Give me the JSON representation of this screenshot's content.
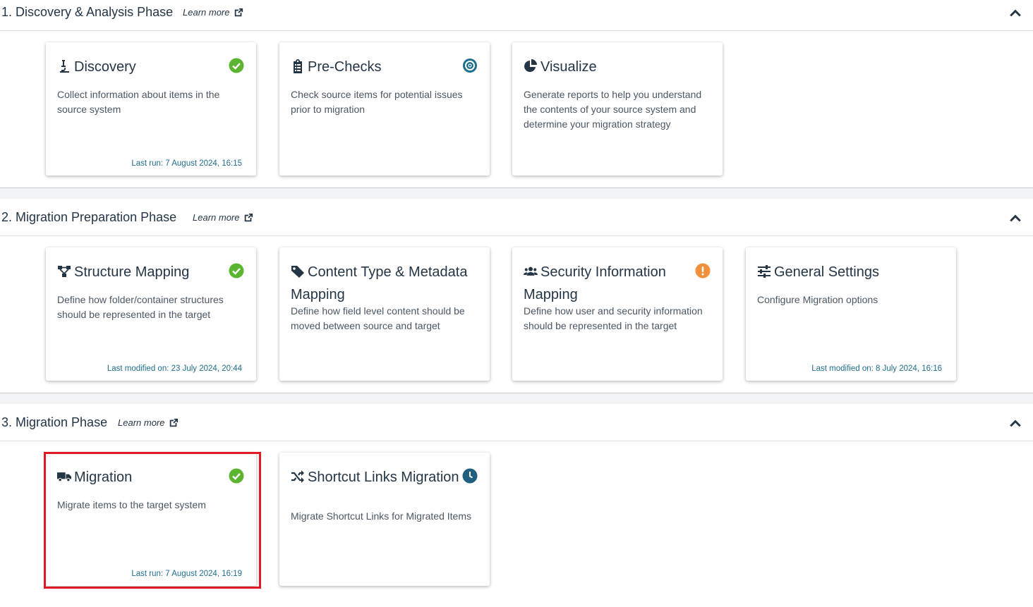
{
  "phases": [
    {
      "title": "1. Discovery & Analysis Phase",
      "learn_more": "Learn more",
      "cards": [
        {
          "title": "Discovery",
          "icon": "microscope-icon",
          "desc": "Collect information about items in the source system",
          "footer": "Last run: 7 August 2024, 16:15",
          "status": "complete"
        },
        {
          "title": "Pre-Checks",
          "icon": "clipboard-list-icon",
          "desc": "Check source items for potential issues prior to migration",
          "footer": "",
          "status": "target"
        },
        {
          "title": "Visualize",
          "icon": "pie-chart-icon",
          "desc": "Generate reports to help you understand the contents of your source system and determine your migration strategy",
          "footer": "",
          "status": "none"
        }
      ]
    },
    {
      "title": "2. Migration Preparation Phase",
      "learn_more": "Learn more",
      "cards": [
        {
          "title": "Structure Mapping",
          "icon": "sitemap-icon",
          "desc": "Define how folder/container structures should be represented in the target",
          "footer": "Last modified on: 23 July 2024, 20:44",
          "status": "complete"
        },
        {
          "title": "Content Type & Metadata Mapping",
          "icon": "tag-icon",
          "desc": "Define how field level content should be moved between source and target",
          "footer": "",
          "status": "none"
        },
        {
          "title": "Security Information Mapping",
          "icon": "users-icon",
          "desc": "Define how user and security information should be represented in the target",
          "footer": "",
          "status": "warning"
        },
        {
          "title": "General Settings",
          "icon": "sliders-icon",
          "desc": "Configure Migration options",
          "footer": "Last modified on: 8 July 2024, 16:16",
          "status": "none"
        }
      ]
    },
    {
      "title": "3. Migration Phase",
      "learn_more": "Learn more",
      "cards": [
        {
          "title": "Migration",
          "icon": "truck-icon",
          "desc": "Migrate items to the target system",
          "footer": "Last run: 7 August 2024, 16:19",
          "status": "complete"
        },
        {
          "title": "Shortcut Links Migration",
          "icon": "shuffle-icon",
          "desc": "Migrate Shortcut Links for Migrated Items",
          "footer": "",
          "status": "scheduled"
        }
      ]
    }
  ],
  "colors": {
    "complete": "#5cb531",
    "target": "#1f6e8c",
    "warning": "#f0913a",
    "scheduled": "#1f5f7f",
    "highlight": "#e01a22"
  }
}
